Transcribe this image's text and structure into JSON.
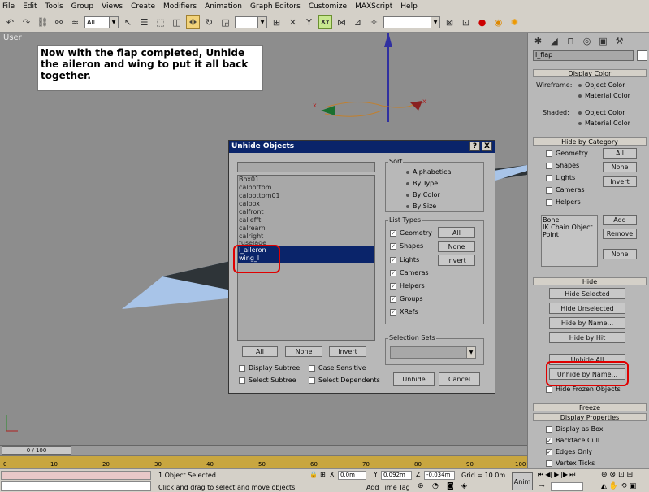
{
  "menu": [
    "File",
    "Edit",
    "Tools",
    "Group",
    "Views",
    "Create",
    "Modifiers",
    "Animation",
    "Graph Editors",
    "Customize",
    "MAXScript",
    "Help"
  ],
  "toolbar": {
    "filter_value": "All",
    "xy_label": "XY",
    "selection_set_value": ""
  },
  "viewport": {
    "label": "User",
    "note": "Now with the flap completed, Unhide the aileron and wing to put it all back together.",
    "axis_x": "x",
    "axis_z": "z",
    "axis_x2": "x"
  },
  "dialog": {
    "title": "Unhide Objects",
    "help_button": "?",
    "close_button": "X",
    "filter_value": "",
    "objects": [
      "Box01",
      "calbottom",
      "calbottom01",
      "calbox",
      "calfront",
      "callefft",
      "calrearn",
      "calright",
      "fuselage",
      "l_aileron",
      "wing_l"
    ],
    "selected": [
      "l_aileron",
      "wing_l"
    ],
    "sort": {
      "label": "Sort",
      "options": [
        "Alphabetical",
        "By Type",
        "By Color",
        "By Size"
      ],
      "selected": "Alphabetical"
    },
    "list_types": {
      "label": "List Types",
      "items": [
        "Geometry",
        "Shapes",
        "Lights",
        "Cameras",
        "Helpers",
        "Groups",
        "XRefs"
      ],
      "all": "All",
      "none": "None",
      "invert": "Invert"
    },
    "selection_sets": {
      "label": "Selection Sets",
      "value": ""
    },
    "all_button": "All",
    "none_button": "None",
    "invert_button": "Invert",
    "display_subtree": "Display Subtree",
    "case_sensitive": "Case Sensitive",
    "select_subtree": "Select Subtree",
    "select_dependents": "Select Dependents",
    "unhide_button": "Unhide",
    "cancel_button": "Cancel"
  },
  "panel": {
    "object_name": "l_flap",
    "display_color": {
      "title": "Display Color",
      "wireframe": "Wireframe:",
      "shaded": "Shaded:",
      "object_color": "Object Color",
      "material_color": "Material Color"
    },
    "hide_by_category": {
      "title": "Hide by Category",
      "items": [
        "Geometry",
        "Shapes",
        "Lights",
        "Cameras",
        "Helpers"
      ],
      "all": "All",
      "none": "None",
      "invert": "Invert",
      "list": [
        "Bone",
        "IK Chain Object",
        "Point"
      ],
      "add": "Add",
      "remove": "Remove",
      "none2": "None"
    },
    "hide": {
      "title": "Hide",
      "hide_selected": "Hide Selected",
      "hide_unselected": "Hide Unselected",
      "hide_by_name": "Hide by Name...",
      "hide_by_hit": "Hide by Hit",
      "unhide_all": "Unhide All",
      "unhide_by_name": "Unhide by Name...",
      "hide_frozen": "Hide Frozen Objects"
    },
    "freeze": {
      "title": "Freeze"
    },
    "display_properties": {
      "title": "Display Properties",
      "display_as_box": "Display as Box",
      "backface_cull": "Backface Cull",
      "edges_only": "Edges Only",
      "vertex_ticks": "Vertex Ticks"
    }
  },
  "timeline": {
    "frame": "0 / 100",
    "ticks": [
      "0",
      "10",
      "20",
      "30",
      "40",
      "50",
      "60",
      "70",
      "80",
      "90",
      "100"
    ]
  },
  "status": {
    "selection": "1 Object Selected",
    "prompt": "Click and drag to select and move objects",
    "x": "0.0m",
    "y": "0.092m",
    "z": "-0.034m",
    "grid": "Grid = 10.0m",
    "add_time_tag": "Add Time Tag",
    "auto_key": "Anim"
  },
  "colors": {
    "accent": "#0a246a",
    "highlight": "#e00000",
    "wing_blue": "#a8c4e8"
  }
}
